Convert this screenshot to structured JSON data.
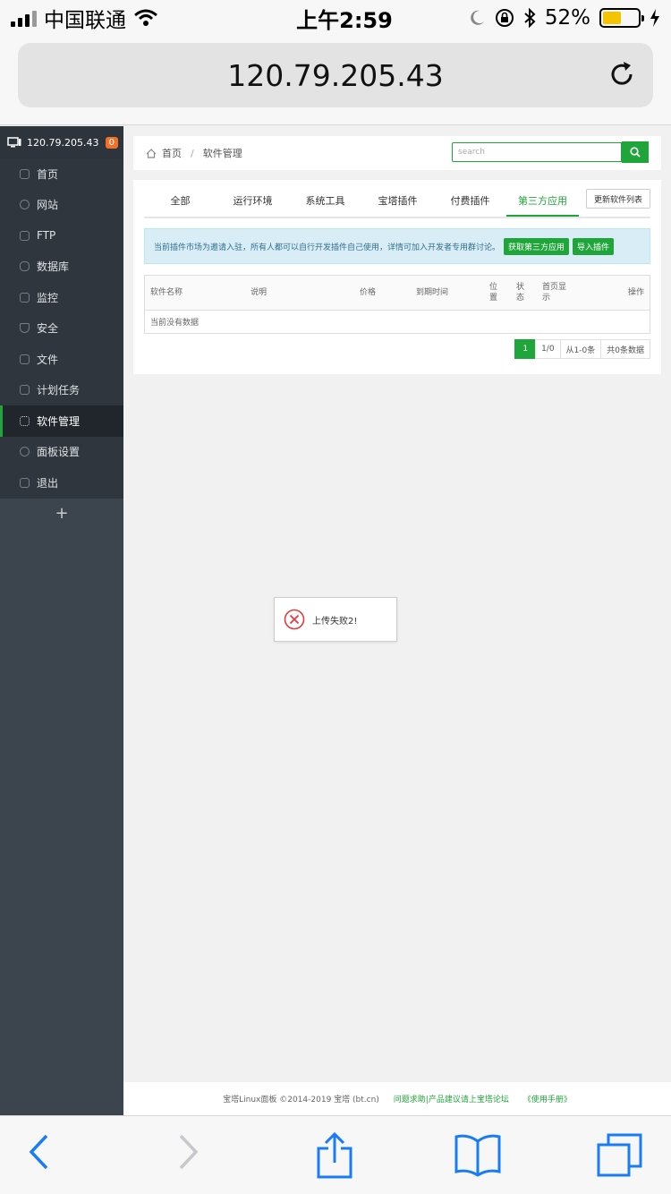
{
  "status_bar": {
    "carrier": "中国联通",
    "time": "上午2:59",
    "battery": "52%"
  },
  "browser": {
    "url": "120.79.205.43"
  },
  "sidebar": {
    "server": "120.79.205.43",
    "badge": "0",
    "items": [
      {
        "label": "首页"
      },
      {
        "label": "网站"
      },
      {
        "label": "FTP"
      },
      {
        "label": "数据库"
      },
      {
        "label": "监控"
      },
      {
        "label": "安全"
      },
      {
        "label": "文件"
      },
      {
        "label": "计划任务"
      },
      {
        "label": "软件管理"
      },
      {
        "label": "面板设置"
      },
      {
        "label": "退出"
      }
    ],
    "add": "+"
  },
  "breadcrumb": {
    "home": "首页",
    "separator": "/",
    "current": "软件管理"
  },
  "search": {
    "placeholder": "search"
  },
  "tabs": [
    {
      "label": "全部"
    },
    {
      "label": "运行环境"
    },
    {
      "label": "系统工具"
    },
    {
      "label": "宝塔插件"
    },
    {
      "label": "付费插件"
    },
    {
      "label": "第三方应用"
    }
  ],
  "update_button": "更新软件列表",
  "alert": {
    "text": "当前插件市场为邀请入驻，所有人都可以自行开发插件自己使用，详情可加入开发者专用群讨论。",
    "get_button": "获取第三方应用",
    "import_button": "导入插件"
  },
  "table": {
    "columns": [
      "软件名称",
      "说明",
      "价格",
      "到期时间",
      "位置",
      "状态",
      "首页显示",
      "操作"
    ],
    "empty_text": "当前没有数据"
  },
  "pager": {
    "current": "1",
    "pages": "1/0",
    "range": "从1-0条",
    "total": "共0条数据"
  },
  "toast": {
    "message": "上传失败2!"
  },
  "footer": {
    "copyright": "宝塔Linux面板 ©2014-2019 宝塔 (bt.cn)",
    "forum_link": "问题求助|产品建议请上宝塔论坛",
    "manual_link": "《使用手册》"
  },
  "colors": {
    "accent": "#20a53a",
    "sidebar": "#3c444d",
    "alert_bg": "#d9edf7",
    "badge": "#f0712a",
    "error": "#e4393c"
  }
}
